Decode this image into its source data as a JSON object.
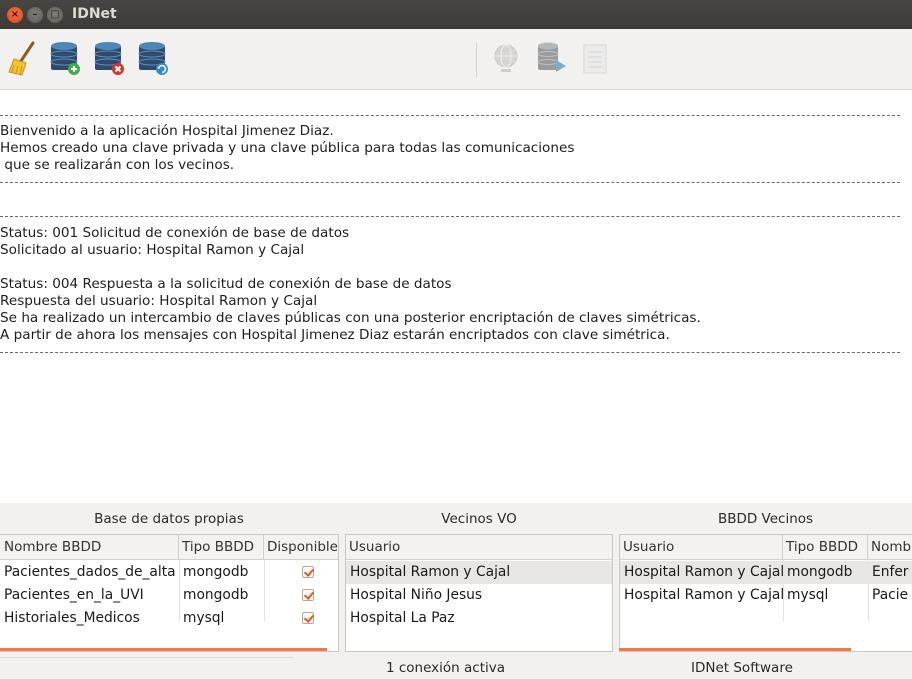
{
  "window": {
    "title": "IDNet"
  },
  "toolbar": {
    "buttons": [
      {
        "name": "clear-icon",
        "enabled": true
      },
      {
        "name": "add-database-icon",
        "enabled": true
      },
      {
        "name": "remove-database-icon",
        "enabled": true
      },
      {
        "name": "refresh-database-icon",
        "enabled": true
      },
      {
        "name": "connect-globe-icon",
        "enabled": false
      },
      {
        "name": "send-database-icon",
        "enabled": false
      },
      {
        "name": "database-document-icon",
        "enabled": false
      }
    ]
  },
  "log": {
    "rule": "------------------------------------------------------------------------------------------------------------------------------------------------------------------------------------------------------------",
    "welcome": [
      "Bienvenido a la aplicación Hospital Jimenez Diaz.",
      "Hemos creado una clave privada y una clave pública para todas las comunicaciones",
      " que se realizarán con los vecinos."
    ],
    "status1": [
      "Status: 001 Solicitud de conexión de base de datos",
      "Solicitado al usuario: Hospital Ramon y Cajal"
    ],
    "status2": [
      "Status: 004 Respuesta a la solicitud de conexión de base de datos",
      "Respuesta del usuario: Hospital Ramon y Cajal",
      "Se ha realizado un intercambio de claves públicas con una posterior encriptación de claves simétricas.",
      "A partir de ahora los mensajes con Hospital Jimenez Diaz estarán encriptados con clave simétrica."
    ]
  },
  "own_db": {
    "title": "Base de datos propias",
    "headers": [
      "Nombre BBDD",
      "Tipo BBDD",
      "Disponible"
    ],
    "rows": [
      {
        "name": "Pacientes_dados_de_alta",
        "type": "mongodb",
        "available": true
      },
      {
        "name": "Pacientes_en_la_UVI",
        "type": "mongodb",
        "available": true
      },
      {
        "name": "Historiales_Medicos",
        "type": "mysql",
        "available": true
      }
    ]
  },
  "neighbors": {
    "title": "Vecinos VO",
    "headers": [
      "Usuario"
    ],
    "rows": [
      "Hospital Ramon y Cajal",
      "Hospital Niño Jesus",
      "Hospital La Paz"
    ],
    "selected_index": 0
  },
  "neighbor_db": {
    "title": "BBDD Vecinos",
    "headers": [
      "Usuario",
      "Tipo BBDD",
      "Nombre"
    ],
    "header_visible": [
      "Usuario",
      "Tipo BBDD",
      "Nomb"
    ],
    "rows": [
      {
        "user": "Hospital Ramon y Cajal",
        "type": "mongodb",
        "name": "Enfer"
      },
      {
        "user": "Hospital Ramon y Cajal",
        "type": "mysql",
        "name": "Pacie"
      }
    ],
    "selected_index": 0
  },
  "statusbar": {
    "connections": "1 conexión activa",
    "brand": "IDNet Software"
  },
  "colors": {
    "accent": "#e95420",
    "titlebar": "#3c3b37"
  }
}
